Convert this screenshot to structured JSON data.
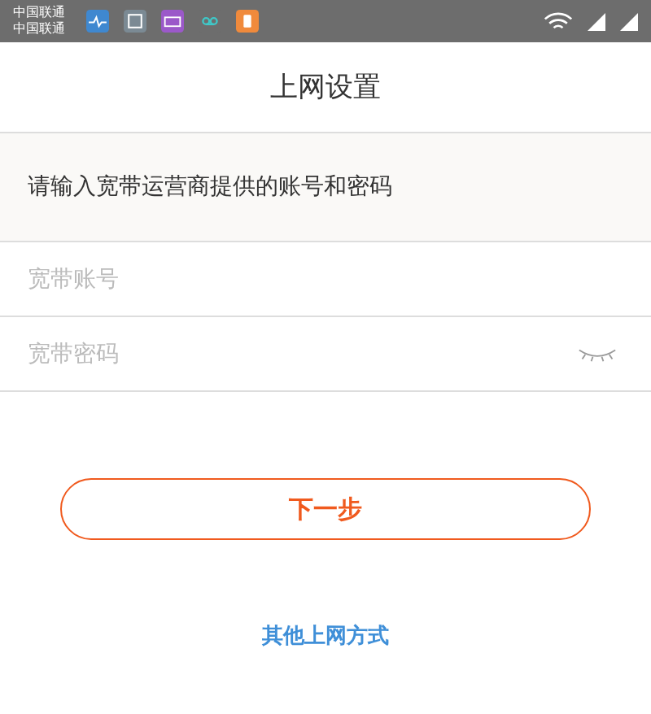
{
  "status_bar": {
    "carriers": [
      "中国联通",
      "中国联通"
    ]
  },
  "header": {
    "title": "上网设置"
  },
  "prompt": "请输入宽带运营商提供的账号和密码",
  "fields": [
    {
      "placeholder": "宽带账号",
      "kind": "text"
    },
    {
      "placeholder": "宽带密码",
      "kind": "password"
    }
  ],
  "next_button": "下一步",
  "other_link": "其他上网方式"
}
